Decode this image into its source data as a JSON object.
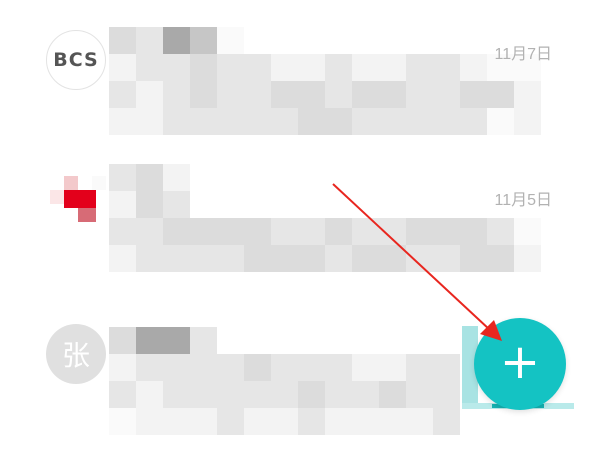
{
  "messages": [
    {
      "avatar": {
        "type": "logo",
        "text": "BCS",
        "accent_color": "#c0392b"
      },
      "sender": "",
      "preview": "",
      "date": "11月7日"
    },
    {
      "avatar": {
        "type": "red-cross-logo",
        "accent_color": "#e3001b"
      },
      "sender": "",
      "preview": "",
      "date": "11月5日"
    },
    {
      "avatar": {
        "type": "initial",
        "text": "张",
        "background": "#e0e0e0"
      },
      "sender": "",
      "preview": "",
      "date": ""
    }
  ],
  "fab": {
    "icon": "plus-icon",
    "label": "+",
    "color": "#14c3c3"
  },
  "annotation": {
    "type": "arrow",
    "color": "#e8261f",
    "points_to": "fab"
  },
  "colors": {
    "timestamp": "#b2b2b2",
    "mosaic_light": "#f1f1f1",
    "mosaic_mid": "#e3e3e3",
    "mosaic_dark": "#a8a8a8"
  }
}
